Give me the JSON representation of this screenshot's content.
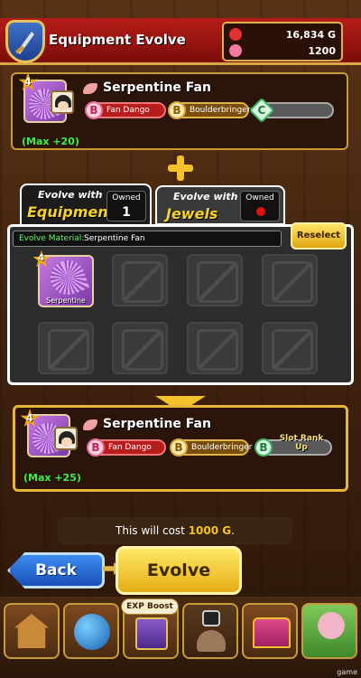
{
  "header": {
    "title": "Equipment Evolve"
  },
  "currency": {
    "gold": "16,834 G",
    "gems": "1200"
  },
  "source_equipment": {
    "rarity": "4",
    "name": "Serpentine Fan",
    "max_label": "(Max +20)",
    "abilities": [
      {
        "rank": "B",
        "name": "Fan Dango"
      },
      {
        "rank": "B",
        "name": "Boulderbringer"
      },
      {
        "rank": "C",
        "name": ""
      }
    ]
  },
  "tabs": [
    {
      "line1": "Evolve with",
      "line2": "Equipment",
      "owned_label": "Owned",
      "owned_value": "1",
      "active": true
    },
    {
      "line1": "Evolve with",
      "line2": "Jewels",
      "owned_label": "Owned",
      "owned_value": "",
      "active": false
    }
  ],
  "material": {
    "label": "Evolve Material:",
    "value": "Serpentine Fan",
    "reselect_label": "Reselect",
    "slot_item": {
      "rarity": "4",
      "name": "Serpentine Fan"
    }
  },
  "result_equipment": {
    "rarity": "4",
    "name": "Serpentine Fan",
    "max_label": "(Max +25)",
    "abilities": [
      {
        "rank": "B",
        "name": "Fan Dango"
      },
      {
        "rank": "B",
        "name": "Boulderbringer"
      },
      {
        "rank": "B",
        "name": "Slot Rank Up"
      }
    ]
  },
  "cost_text": {
    "prefix": "This will cost ",
    "amount": "1000 G",
    "suffix": "."
  },
  "buttons": {
    "back": "Back",
    "evolve": "Evolve"
  },
  "nav": {
    "exp_boost": "EXP Boost"
  },
  "watermark": "game",
  "colors": {
    "header_red": "#b51d17",
    "gold_accent": "#f3c22a",
    "max_green": "#3bf04b",
    "back_blue": "#2a6fd8"
  }
}
